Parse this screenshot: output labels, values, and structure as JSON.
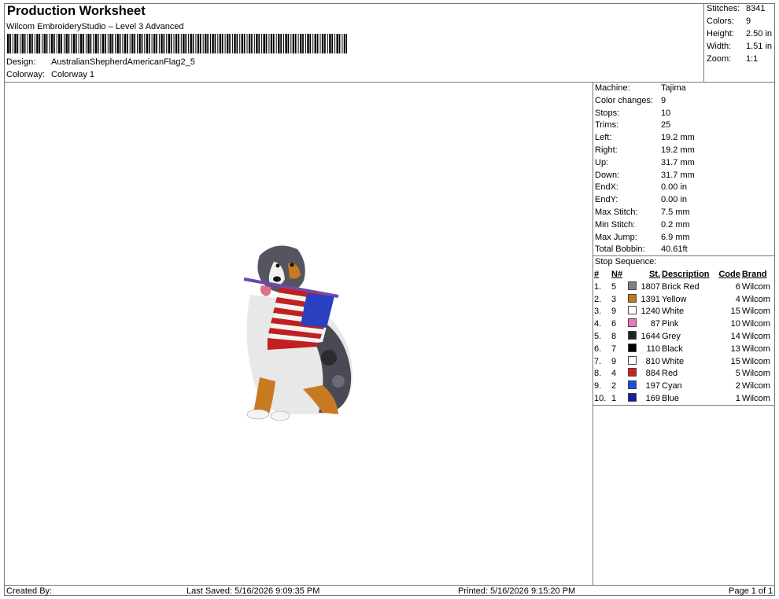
{
  "header": {
    "title": "Production Worksheet",
    "subtitle": "Wilcom EmbroideryStudio – Level 3 Advanced",
    "design_label": "Design:",
    "design_value": "AustralianShepherdAmericanFlag2_5",
    "colorway_label": "Colorway:",
    "colorway_value": "Colorway 1"
  },
  "summary": [
    {
      "label": "Stitches:",
      "value": "8341"
    },
    {
      "label": "Colors:",
      "value": "9"
    },
    {
      "label": "Height:",
      "value": "2.50 in"
    },
    {
      "label": "Width:",
      "value": "1.51 in"
    },
    {
      "label": "Zoom:",
      "value": "1:1"
    }
  ],
  "specs": [
    {
      "label": "Machine:",
      "value": "Tajima"
    },
    {
      "label": "Color changes:",
      "value": "9"
    },
    {
      "label": "Stops:",
      "value": "10"
    },
    {
      "label": "Trims:",
      "value": "25"
    },
    {
      "label": "Left:",
      "value": "19.2 mm"
    },
    {
      "label": "Right:",
      "value": "19.2 mm"
    },
    {
      "label": "Up:",
      "value": "31.7 mm"
    },
    {
      "label": "Down:",
      "value": "31.7 mm"
    },
    {
      "label": "EndX:",
      "value": "0.00 in"
    },
    {
      "label": "EndY:",
      "value": "0.00 in"
    },
    {
      "label": "Max Stitch:",
      "value": "7.5 mm"
    },
    {
      "label": "Min Stitch:",
      "value": "0.2 mm"
    },
    {
      "label": "Max Jump:",
      "value": "6.9 mm"
    },
    {
      "label": "Total Bobbin:",
      "value": "40.61ft"
    }
  ],
  "stop_sequence": {
    "heading": "Stop Sequence:",
    "columns": [
      "#",
      "N#",
      "St.",
      "Description",
      "Code",
      "Brand"
    ],
    "rows": [
      {
        "num": "1.",
        "n": "5",
        "color": "#808080",
        "st": "1807",
        "desc": "Brick Red",
        "code": "6",
        "brand": "Wilcom"
      },
      {
        "num": "2.",
        "n": "3",
        "color": "#c07a1a",
        "st": "1391",
        "desc": "Yellow",
        "code": "4",
        "brand": "Wilcom"
      },
      {
        "num": "3.",
        "n": "9",
        "color": "#ffffff",
        "st": "1240",
        "desc": "White",
        "code": "15",
        "brand": "Wilcom"
      },
      {
        "num": "4.",
        "n": "6",
        "color": "#e879c0",
        "st": "87",
        "desc": "Pink",
        "code": "10",
        "brand": "Wilcom"
      },
      {
        "num": "5.",
        "n": "8",
        "color": "#222222",
        "st": "1644",
        "desc": "Grey",
        "code": "14",
        "brand": "Wilcom"
      },
      {
        "num": "6.",
        "n": "7",
        "color": "#000000",
        "st": "110",
        "desc": "Black",
        "code": "13",
        "brand": "Wilcom"
      },
      {
        "num": "7.",
        "n": "9",
        "color": "#ffffff",
        "st": "810",
        "desc": "White",
        "code": "15",
        "brand": "Wilcom"
      },
      {
        "num": "8.",
        "n": "4",
        "color": "#d42020",
        "st": "884",
        "desc": "Red",
        "code": "5",
        "brand": "Wilcom"
      },
      {
        "num": "9.",
        "n": "2",
        "color": "#1a4fe0",
        "st": "197",
        "desc": "Cyan",
        "code": "2",
        "brand": "Wilcom"
      },
      {
        "num": "10.",
        "n": "1",
        "color": "#1a1aa8",
        "st": "169",
        "desc": "Blue",
        "code": "1",
        "brand": "Wilcom"
      }
    ]
  },
  "footer": {
    "created_by": "Created By:",
    "last_saved": "Last Saved: 5/16/2026 9:09:35 PM",
    "printed": "Printed: 5/16/2026 9:15:20 PM",
    "page": "Page 1 of 1"
  }
}
